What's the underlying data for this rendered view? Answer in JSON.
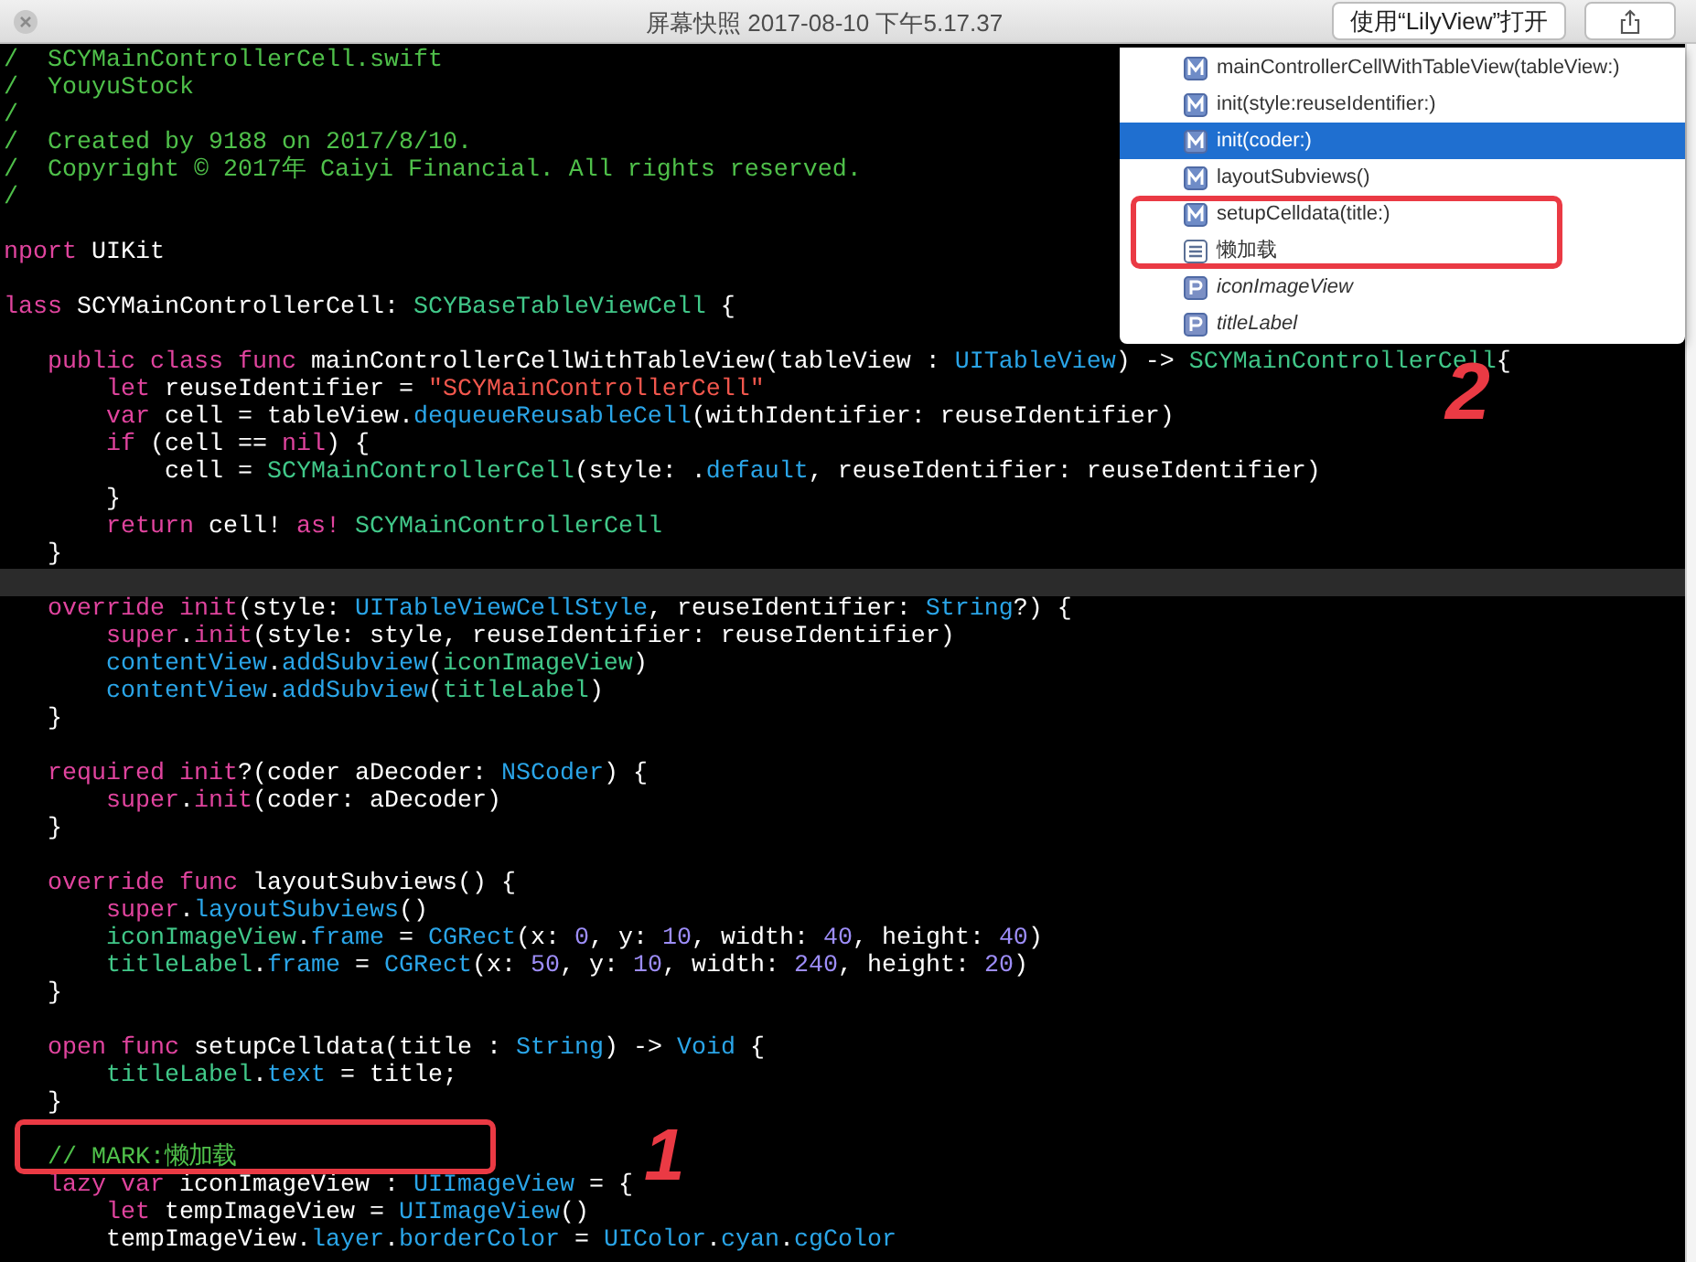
{
  "window": {
    "title": "屏幕快照 2017-08-10 下午5.17.37",
    "open_button": "使用“LilyView”打开"
  },
  "code_lines": [
    {
      "tokens": [
        {
          "kind": "comment",
          "text": "/  SCYMainControllerCell.swift"
        }
      ]
    },
    {
      "tokens": [
        {
          "kind": "comment",
          "text": "/  YouyuStock"
        }
      ]
    },
    {
      "tokens": [
        {
          "kind": "comment",
          "text": "/"
        }
      ]
    },
    {
      "tokens": [
        {
          "kind": "comment",
          "text": "/  Created by 9188 on 2017/8/10."
        }
      ]
    },
    {
      "tokens": [
        {
          "kind": "comment",
          "text": "/  Copyright © 2017年 Caiyi Financial. All rights reserved."
        }
      ]
    },
    {
      "tokens": [
        {
          "kind": "comment",
          "text": "/"
        }
      ]
    },
    {
      "kind": "blank"
    },
    {
      "tokens": [
        {
          "kind": "keyword",
          "text": "nport"
        },
        {
          "kind": "plain",
          "text": " UIKit"
        }
      ]
    },
    {
      "kind": "blank"
    },
    {
      "tokens": [
        {
          "kind": "keyword",
          "text": "lass"
        },
        {
          "kind": "plain",
          "text": " SCYMainControllerCell: "
        },
        {
          "kind": "project",
          "text": "SCYBaseTableViewCell"
        },
        {
          "kind": "plain",
          "text": " {"
        }
      ]
    },
    {
      "kind": "blank"
    },
    {
      "tokens": [
        {
          "kind": "keyword",
          "text": "   public class func"
        },
        {
          "kind": "plain",
          "text": " mainControllerCellWithTableView(tableView : "
        },
        {
          "kind": "system",
          "text": "UITableView"
        },
        {
          "kind": "plain",
          "text": ") -> "
        },
        {
          "kind": "project",
          "text": "SCYMainControllerCell"
        },
        {
          "kind": "plain",
          "text": "{"
        }
      ]
    },
    {
      "tokens": [
        {
          "kind": "keyword",
          "text": "       let"
        },
        {
          "kind": "plain",
          "text": " reuseIdentifier = "
        },
        {
          "kind": "string",
          "text": "\"SCYMainControllerCell\""
        }
      ]
    },
    {
      "tokens": [
        {
          "kind": "keyword",
          "text": "       var"
        },
        {
          "kind": "plain",
          "text": " cell = tableView."
        },
        {
          "kind": "system",
          "text": "dequeueReusableCell"
        },
        {
          "kind": "plain",
          "text": "(withIdentifier: reuseIdentifier)"
        }
      ]
    },
    {
      "tokens": [
        {
          "kind": "keyword",
          "text": "       if"
        },
        {
          "kind": "plain",
          "text": " (cell == "
        },
        {
          "kind": "keyword",
          "text": "nil"
        },
        {
          "kind": "plain",
          "text": ") {"
        }
      ]
    },
    {
      "tokens": [
        {
          "kind": "plain",
          "text": "           cell = "
        },
        {
          "kind": "project",
          "text": "SCYMainControllerCell"
        },
        {
          "kind": "plain",
          "text": "(style: ."
        },
        {
          "kind": "system",
          "text": "default"
        },
        {
          "kind": "plain",
          "text": ", reuseIdentifier: reuseIdentifier)"
        }
      ]
    },
    {
      "tokens": [
        {
          "kind": "plain",
          "text": "       }"
        }
      ]
    },
    {
      "tokens": [
        {
          "kind": "keyword",
          "text": "       return"
        },
        {
          "kind": "plain",
          "text": " cell! "
        },
        {
          "kind": "keyword",
          "text": "as! "
        },
        {
          "kind": "project",
          "text": "SCYMainControllerCell"
        }
      ]
    },
    {
      "tokens": [
        {
          "kind": "plain",
          "text": "   }"
        }
      ]
    },
    {
      "kind": "current"
    },
    {
      "tokens": [
        {
          "kind": "keyword",
          "text": "   override init"
        },
        {
          "kind": "plain",
          "text": "(style: "
        },
        {
          "kind": "system",
          "text": "UITableViewCellStyle"
        },
        {
          "kind": "plain",
          "text": ", reuseIdentifier: "
        },
        {
          "kind": "system",
          "text": "String"
        },
        {
          "kind": "plain",
          "text": "?) {"
        }
      ]
    },
    {
      "tokens": [
        {
          "kind": "keyword",
          "text": "       super"
        },
        {
          "kind": "plain",
          "text": "."
        },
        {
          "kind": "keyword",
          "text": "init"
        },
        {
          "kind": "plain",
          "text": "(style: style, reuseIdentifier: reuseIdentifier)"
        }
      ]
    },
    {
      "tokens": [
        {
          "kind": "system",
          "text": "       contentView"
        },
        {
          "kind": "plain",
          "text": "."
        },
        {
          "kind": "system",
          "text": "addSubview"
        },
        {
          "kind": "plain",
          "text": "("
        },
        {
          "kind": "project",
          "text": "iconImageView"
        },
        {
          "kind": "plain",
          "text": ")"
        }
      ]
    },
    {
      "tokens": [
        {
          "kind": "system",
          "text": "       contentView"
        },
        {
          "kind": "plain",
          "text": "."
        },
        {
          "kind": "system",
          "text": "addSubview"
        },
        {
          "kind": "plain",
          "text": "("
        },
        {
          "kind": "project",
          "text": "titleLabel"
        },
        {
          "kind": "plain",
          "text": ")"
        }
      ]
    },
    {
      "tokens": [
        {
          "kind": "plain",
          "text": "   }"
        }
      ]
    },
    {
      "kind": "blank"
    },
    {
      "tokens": [
        {
          "kind": "keyword",
          "text": "   required init"
        },
        {
          "kind": "plain",
          "text": "?(coder aDecoder: "
        },
        {
          "kind": "system",
          "text": "NSCoder"
        },
        {
          "kind": "plain",
          "text": ") {"
        }
      ]
    },
    {
      "tokens": [
        {
          "kind": "keyword",
          "text": "       super"
        },
        {
          "kind": "plain",
          "text": "."
        },
        {
          "kind": "keyword",
          "text": "init"
        },
        {
          "kind": "plain",
          "text": "(coder: aDecoder)"
        }
      ]
    },
    {
      "tokens": [
        {
          "kind": "plain",
          "text": "   }"
        }
      ]
    },
    {
      "kind": "blank"
    },
    {
      "tokens": [
        {
          "kind": "keyword",
          "text": "   override func"
        },
        {
          "kind": "plain",
          "text": " layoutSubviews() {"
        }
      ]
    },
    {
      "tokens": [
        {
          "kind": "keyword",
          "text": "       super"
        },
        {
          "kind": "plain",
          "text": "."
        },
        {
          "kind": "system",
          "text": "layoutSubviews"
        },
        {
          "kind": "plain",
          "text": "()"
        }
      ]
    },
    {
      "tokens": [
        {
          "kind": "project",
          "text": "       iconImageView"
        },
        {
          "kind": "plain",
          "text": "."
        },
        {
          "kind": "system",
          "text": "frame"
        },
        {
          "kind": "plain",
          "text": " = "
        },
        {
          "kind": "system",
          "text": "CGRect"
        },
        {
          "kind": "plain",
          "text": "(x: "
        },
        {
          "kind": "number",
          "text": "0"
        },
        {
          "kind": "plain",
          "text": ", y: "
        },
        {
          "kind": "number",
          "text": "10"
        },
        {
          "kind": "plain",
          "text": ", width: "
        },
        {
          "kind": "number",
          "text": "40"
        },
        {
          "kind": "plain",
          "text": ", height: "
        },
        {
          "kind": "number",
          "text": "40"
        },
        {
          "kind": "plain",
          "text": ")"
        }
      ]
    },
    {
      "tokens": [
        {
          "kind": "project",
          "text": "       titleLabel"
        },
        {
          "kind": "plain",
          "text": "."
        },
        {
          "kind": "system",
          "text": "frame"
        },
        {
          "kind": "plain",
          "text": " = "
        },
        {
          "kind": "system",
          "text": "CGRect"
        },
        {
          "kind": "plain",
          "text": "(x: "
        },
        {
          "kind": "number",
          "text": "50"
        },
        {
          "kind": "plain",
          "text": ", y: "
        },
        {
          "kind": "number",
          "text": "10"
        },
        {
          "kind": "plain",
          "text": ", width: "
        },
        {
          "kind": "number",
          "text": "240"
        },
        {
          "kind": "plain",
          "text": ", height: "
        },
        {
          "kind": "number",
          "text": "20"
        },
        {
          "kind": "plain",
          "text": ")"
        }
      ]
    },
    {
      "tokens": [
        {
          "kind": "plain",
          "text": "   }"
        }
      ]
    },
    {
      "kind": "blank"
    },
    {
      "tokens": [
        {
          "kind": "keyword",
          "text": "   open func"
        },
        {
          "kind": "plain",
          "text": " setupCelldata(title : "
        },
        {
          "kind": "system",
          "text": "String"
        },
        {
          "kind": "plain",
          "text": ") -> "
        },
        {
          "kind": "system",
          "text": "Void"
        },
        {
          "kind": "plain",
          "text": " {"
        }
      ]
    },
    {
      "tokens": [
        {
          "kind": "project",
          "text": "       titleLabel"
        },
        {
          "kind": "plain",
          "text": "."
        },
        {
          "kind": "system",
          "text": "text"
        },
        {
          "kind": "plain",
          "text": " = title;"
        }
      ]
    },
    {
      "tokens": [
        {
          "kind": "plain",
          "text": "   }"
        }
      ]
    },
    {
      "kind": "blank"
    },
    {
      "tokens": [
        {
          "kind": "comment",
          "text": "   // MARK:懒加载"
        }
      ]
    },
    {
      "tokens": [
        {
          "kind": "keyword",
          "text": "   lazy var"
        },
        {
          "kind": "plain",
          "text": " iconImageView : "
        },
        {
          "kind": "system",
          "text": "UIImageView"
        },
        {
          "kind": "plain",
          "text": " = {"
        }
      ]
    },
    {
      "tokens": [
        {
          "kind": "keyword",
          "text": "       let"
        },
        {
          "kind": "plain",
          "text": " tempImageView = "
        },
        {
          "kind": "system",
          "text": "UIImageView"
        },
        {
          "kind": "plain",
          "text": "()"
        }
      ]
    },
    {
      "tokens": [
        {
          "kind": "plain",
          "text": "       tempImageView."
        },
        {
          "kind": "system",
          "text": "layer"
        },
        {
          "kind": "plain",
          "text": "."
        },
        {
          "kind": "system",
          "text": "borderColor"
        },
        {
          "kind": "plain",
          "text": " = "
        },
        {
          "kind": "system",
          "text": "UIColor"
        },
        {
          "kind": "plain",
          "text": "."
        },
        {
          "kind": "system",
          "text": "cyan"
        },
        {
          "kind": "plain",
          "text": "."
        },
        {
          "kind": "system",
          "text": "cgColor"
        }
      ]
    }
  ],
  "symbol_menu": [
    {
      "kind": "method",
      "label": "mainControllerCellWithTableView(tableView:)",
      "selected": false
    },
    {
      "kind": "method",
      "label": "init(style:reuseIdentifier:)",
      "selected": false
    },
    {
      "kind": "method",
      "label": "init(coder:)",
      "selected": true
    },
    {
      "kind": "method",
      "label": "layoutSubviews()",
      "selected": false
    },
    {
      "kind": "method",
      "label": "setupCelldata(title:)",
      "selected": false
    },
    {
      "kind": "mark",
      "label": "懒加载",
      "selected": false
    },
    {
      "kind": "property",
      "label": "iconImageView",
      "selected": false
    },
    {
      "kind": "property",
      "label": "titleLabel",
      "selected": false
    }
  ],
  "annotations": [
    {
      "kind": "code_box"
    },
    {
      "kind": "menu_box"
    },
    {
      "kind": "number",
      "text": "1"
    },
    {
      "kind": "number",
      "text": "2"
    }
  ]
}
